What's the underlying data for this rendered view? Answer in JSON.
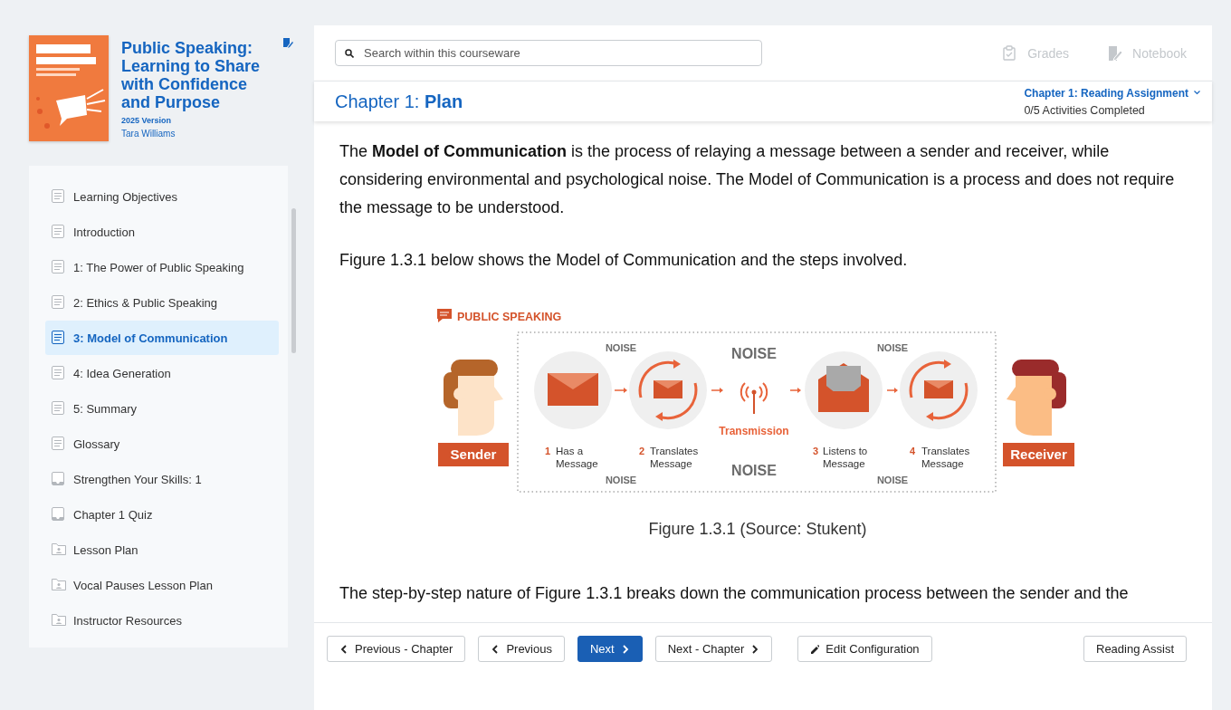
{
  "book": {
    "title": "Public Speaking: Learning to Share with Confidence and Purpose",
    "edition": "2025 Version",
    "author": "Tara Williams"
  },
  "toc": [
    {
      "label": "Learning Objectives",
      "kind": "page",
      "selected": false
    },
    {
      "label": "Introduction",
      "kind": "page",
      "selected": false
    },
    {
      "label": "1: The Power of Public Speaking",
      "kind": "page",
      "selected": false
    },
    {
      "label": "2: Ethics & Public Speaking",
      "kind": "page",
      "selected": false
    },
    {
      "label": "3: Model of Communication",
      "kind": "page",
      "selected": true
    },
    {
      "label": "4: Idea Generation",
      "kind": "page",
      "selected": false
    },
    {
      "label": "5: Summary",
      "kind": "page",
      "selected": false
    },
    {
      "label": "Glossary",
      "kind": "page",
      "selected": false
    },
    {
      "label": "Strengthen Your Skills: 1",
      "kind": "quiz",
      "selected": false
    },
    {
      "label": "Chapter 1 Quiz",
      "kind": "quiz",
      "selected": false
    },
    {
      "label": "Lesson Plan",
      "kind": "folder",
      "selected": false
    },
    {
      "label": "Vocal Pauses Lesson Plan",
      "kind": "folder",
      "selected": false
    },
    {
      "label": "Instructor Resources",
      "kind": "folder",
      "selected": false
    }
  ],
  "search": {
    "placeholder": "Search within this courseware"
  },
  "top_links": [
    {
      "label": "Grades",
      "kind": "grades",
      "disabled": true
    },
    {
      "label": "Notebook",
      "kind": "notebook",
      "disabled": true
    }
  ],
  "chapter": {
    "title": "Chapter 1: **Plan**",
    "assignment": "Chapter 1: Reading Assignment",
    "progress": "0/5 Activities Completed"
  },
  "content": {
    "paragraphs": [
      "The **Model of Communication** is the process of relaying a message between a sender and receiver, while considering environmental and psychological noise. The Model of Communication is a process and does not require the message to be understood.",
      "Figure 1.3.1 below shows the Model of Communication and the steps involved."
    ],
    "figure": {
      "brand": "PUBLIC SPEAKING",
      "sender": "Sender",
      "receiver": "Receiver",
      "transmission": "Transmission",
      "noise": [
        "NOISE",
        "NOISE",
        "NOISE",
        "NOISE",
        "NOISE",
        "NOISE"
      ],
      "steps": [
        {
          "number": "1",
          "lines": [
            "Has a",
            "Message"
          ]
        },
        {
          "number": "2",
          "lines": [
            "Translates",
            "Message"
          ]
        },
        {
          "number": "3",
          "lines": [
            "Listens to",
            "Message"
          ]
        },
        {
          "number": "4",
          "lines": [
            "Translates",
            "Message"
          ]
        }
      ]
    },
    "caption": "Figure 1.3.1 (Source: Stukent)",
    "after": "The step-by-step nature of Figure 1.3.1 breaks down the communication process between the sender and the"
  },
  "nav": [
    {
      "label": "Previous - Chapter",
      "kind": "prev",
      "primary": false
    },
    {
      "label": "Previous",
      "kind": "prev",
      "primary": false
    },
    {
      "label": "Next",
      "kind": "next",
      "primary": true
    },
    {
      "label": "Next - Chapter",
      "kind": "next",
      "primary": false
    },
    {
      "label": "Edit Configuration",
      "kind": "edit",
      "primary": false
    },
    {
      "label": "Reading Assist",
      "kind": "plain",
      "primary": false
    }
  ]
}
